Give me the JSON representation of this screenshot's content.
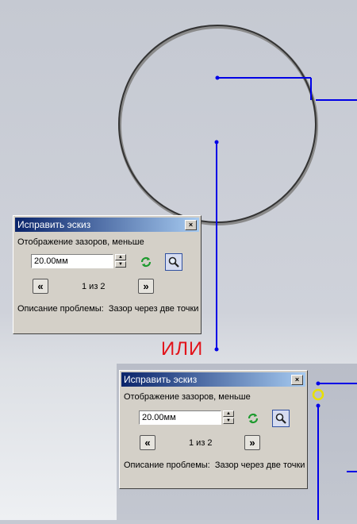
{
  "or_label": "ИЛИ",
  "dialog": {
    "title": "Исправить эскиз",
    "close_label": "×",
    "gap_display_label": "Отображение зазоров, меньше",
    "gap_value": "20.00мм",
    "spin_up": "▲",
    "spin_down": "▼",
    "prev_label": "«",
    "next_label": "»",
    "page_indicator": "1 из 2",
    "problem_label": "Описание проблемы:",
    "problem_text": "Зазор через две точки"
  },
  "icons": {
    "refresh": "refresh-icon",
    "zoom": "magnifier-icon"
  },
  "colors": {
    "sketch_line": "#0000e6",
    "circle": "#333333",
    "or_text": "#e2141b",
    "gap_marker": "#e8e000",
    "title_start": "#0a246a",
    "title_end": "#a6caf0",
    "dialog_bg": "#d4d0c8"
  }
}
